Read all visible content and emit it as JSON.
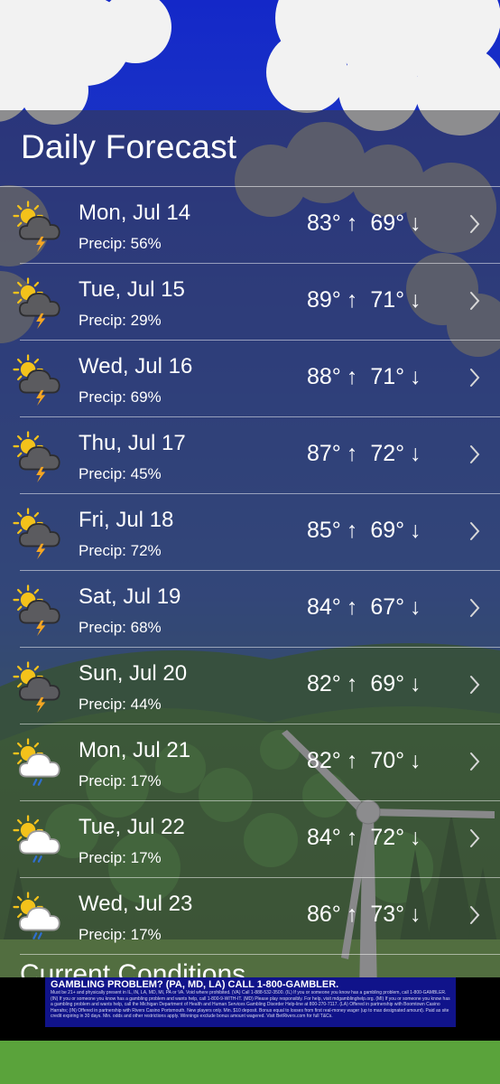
{
  "section_title": "Daily Forecast",
  "next_section_title": "Current Conditions",
  "colors": {
    "sky": "#1d3c98",
    "panel": "rgba(58,58,62,0.55)",
    "text": "#ffffff",
    "sun": "#f3c21b",
    "bolt": "#f5a623",
    "rain": "#2f6fd0",
    "ad_background": "#10138a"
  },
  "days": [
    {
      "date": "Mon, Jul 14",
      "precip": "Precip: 56%",
      "high": "83°",
      "high_arrow": "↑",
      "low": "69°",
      "low_arrow": "↓",
      "icon": "partly-cloudy-thunderstorm-icon"
    },
    {
      "date": "Tue, Jul 15",
      "precip": "Precip: 29%",
      "high": "89°",
      "high_arrow": "↑",
      "low": "71°",
      "low_arrow": "↓",
      "icon": "partly-cloudy-thunderstorm-icon"
    },
    {
      "date": "Wed, Jul 16",
      "precip": "Precip: 69%",
      "high": "88°",
      "high_arrow": "↑",
      "low": "71°",
      "low_arrow": "↓",
      "icon": "partly-cloudy-thunderstorm-icon"
    },
    {
      "date": "Thu, Jul 17",
      "precip": "Precip: 45%",
      "high": "87°",
      "high_arrow": "↑",
      "low": "72°",
      "low_arrow": "↓",
      "icon": "partly-cloudy-thunderstorm-icon"
    },
    {
      "date": "Fri, Jul 18",
      "precip": "Precip: 72%",
      "high": "85°",
      "high_arrow": "↑",
      "low": "69°",
      "low_arrow": "↓",
      "icon": "partly-cloudy-thunderstorm-icon"
    },
    {
      "date": "Sat, Jul 19",
      "precip": "Precip: 68%",
      "high": "84°",
      "high_arrow": "↑",
      "low": "67°",
      "low_arrow": "↓",
      "icon": "partly-cloudy-thunderstorm-icon"
    },
    {
      "date": "Sun, Jul 20",
      "precip": "Precip: 44%",
      "high": "82°",
      "high_arrow": "↑",
      "low": "69°",
      "low_arrow": "↓",
      "icon": "partly-cloudy-thunderstorm-icon"
    },
    {
      "date": "Mon, Jul 21",
      "precip": "Precip: 17%",
      "high": "82°",
      "high_arrow": "↑",
      "low": "70°",
      "low_arrow": "↓",
      "icon": "partly-cloudy-rain-icon"
    },
    {
      "date": "Tue, Jul 22",
      "precip": "Precip: 17%",
      "high": "84°",
      "high_arrow": "↑",
      "low": "72°",
      "low_arrow": "↓",
      "icon": "partly-cloudy-rain-icon"
    },
    {
      "date": "Wed, Jul 23",
      "precip": "Precip: 17%",
      "high": "86°",
      "high_arrow": "↑",
      "low": "73°",
      "low_arrow": "↓",
      "icon": "partly-cloudy-rain-icon"
    }
  ],
  "ad": {
    "headline": "GAMBLING PROBLEM? (PA, MD, LA) CALL 1-800-GAMBLER.",
    "body": "Must be 21+ and physically present in IL, IN, LA, MD, MI, PA or VA. Void where prohibited. (VA) Call 1-888-532-3500. (IL) If you or someone you know has a gambling problem, call 1-800-GAMBLER. (IN) If you or someone you know has a gambling problem and wants help, call 1-800-9-WITH-IT. (MD) Please play responsibly. For help, visit mdgamblinghelp.org. (MI) If you or someone you know has a gambling problem and wants help, call the Michigan Department of Health and Human Services Gambling Disorder Help-line at 800-270-7117. (LA) Offered in partnership with Boomtown Casino Harrahs; (IN) Offered in partnership with Rivers Casino Portsmouth. New players only. Min. $10 deposit. Bonus equal to losses from first real-money wager (up to max designated amount). Paid as site credit expiring in 30 days. Min. odds and other restrictions apply. Winnings exclude bonus amount wagered. Visit BetRivers.com for full T&Cs."
  }
}
